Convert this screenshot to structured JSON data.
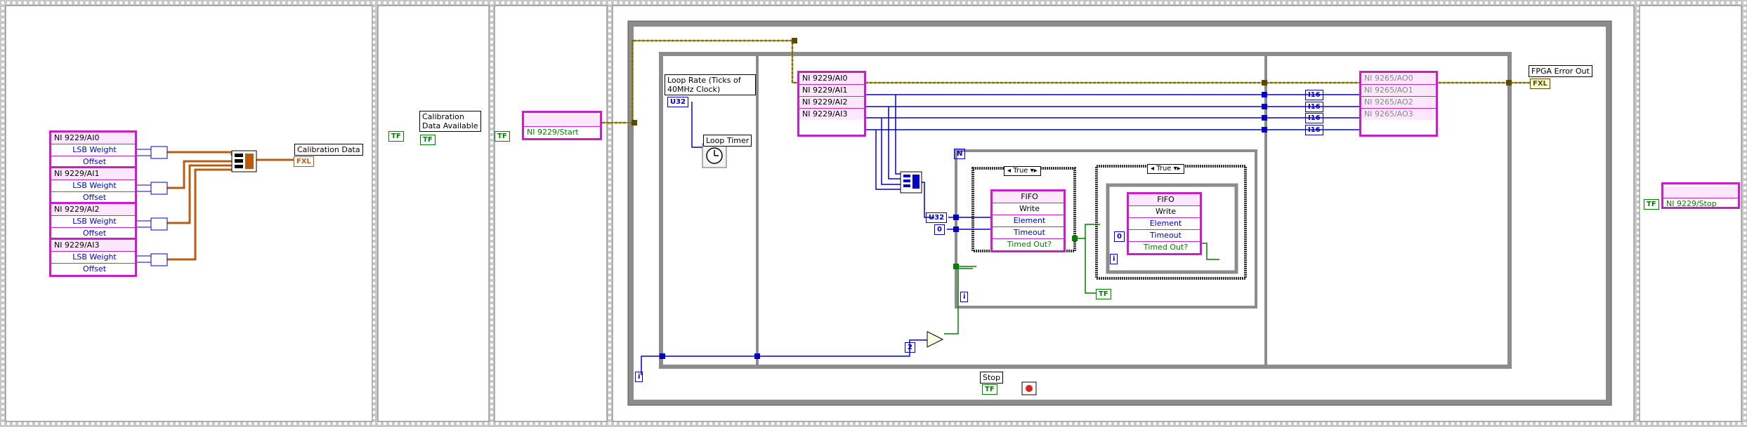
{
  "labels": {
    "calibration_data": "Calibration Data",
    "calibration_available": "Calibration Data Available",
    "loop_rate": "Loop Rate (Ticks of 40MHz Clock)",
    "loop_timer": "Loop Timer",
    "fpga_error_out": "FPGA Error Out",
    "stop": "Stop"
  },
  "ai_nodes": [
    {
      "name": "NI 9229/AI0",
      "row1": "LSB Weight",
      "row2": "Offset"
    },
    {
      "name": "NI 9229/AI1",
      "row1": "LSB Weight",
      "row2": "Offset"
    },
    {
      "name": "NI 9229/AI2",
      "row1": "LSB Weight",
      "row2": "Offset"
    },
    {
      "name": "NI 9229/AI3",
      "row1": "LSB Weight",
      "row2": "Offset"
    }
  ],
  "start_node": "NI 9229/Start",
  "stop_node": "NI 9229/Stop",
  "ai_io": [
    "NI 9229/AI0",
    "NI 9229/AI1",
    "NI 9229/AI2",
    "NI 9229/AI3"
  ],
  "ao_io": [
    "NI 9265/AO0",
    "NI 9265/AO1",
    "NI 9265/AO2",
    "NI 9265/AO3"
  ],
  "fifo_outer": {
    "title": "FIFO",
    "rows": [
      "Write",
      "Element",
      "Timeout",
      "Timed Out?"
    ]
  },
  "fifo_inner": {
    "title": "FIFO",
    "rows": [
      "Write",
      "Element",
      "Timeout",
      "Timed Out?"
    ]
  },
  "case_outer": "True",
  "case_inner": "True",
  "constants": {
    "tf1": "TF",
    "tf2": "TF",
    "tf3": "TF",
    "tf4": "TF",
    "tf5": "TF",
    "u32": "U32",
    "u32b": "U32",
    "zero1": "0",
    "zero2": "0",
    "two": "2",
    "i16": "I16",
    "n": "N",
    "i": "i",
    "fxl": "FXL"
  },
  "colors": {
    "frame_grey": "#9c9c9c",
    "vi_pink": "#c81fc8",
    "wire_orange": "#b85c14",
    "wire_blue": "#0000c8",
    "wire_green": "#008000",
    "wire_yellow": "#c8b400",
    "bool_green": "#008000"
  }
}
